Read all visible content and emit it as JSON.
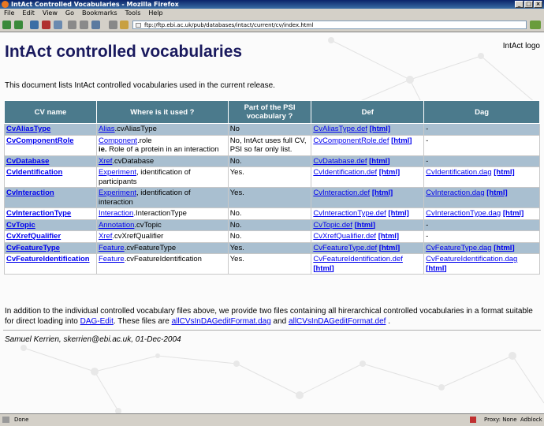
{
  "window": {
    "title": "IntAct Controlled Vocabularies - Mozilla Firefox"
  },
  "menu": [
    "File",
    "Edit",
    "View",
    "Go",
    "Bookmarks",
    "Tools",
    "Help"
  ],
  "address": {
    "url": "ftp://ftp.ebi.ac.uk/pub/databases/intact/current/cv/index.html"
  },
  "page": {
    "title": "IntAct controlled vocabularies",
    "logo_alt": "IntAct logo",
    "intro": "This document lists IntAct controlled vocabularies used in the current release.",
    "table": {
      "headers": [
        "CV name",
        "Where is it used ?",
        "Part of the PSI vocabulary ?",
        "Def",
        "Dag"
      ],
      "rows": [
        {
          "name": "CvAliasType",
          "where_link": "Alias",
          "where_rest": ".cvAliasType",
          "where_extra": "",
          "psi": "No",
          "def": "CvAliasType.def",
          "def_html": "[html]",
          "dag": "-",
          "dag_html": ""
        },
        {
          "name": "CvComponentRole",
          "where_link": "Component",
          "where_rest": ".role",
          "where_extra": "Role of a protein in an interaction",
          "psi": "No, IntAct uses full CV, PSI so far only list.",
          "def": "CvComponentRole.def",
          "def_html": "[html]",
          "dag": "-",
          "dag_html": ""
        },
        {
          "name": "CvDatabase",
          "where_link": "Xref",
          "where_rest": ".cvDatabase",
          "where_extra": "",
          "psi": "No.",
          "def": "CvDatabase.def",
          "def_html": "[html]",
          "dag": "-",
          "dag_html": ""
        },
        {
          "name": "CvIdentification",
          "where_link": "Experiment",
          "where_rest": ", identification of participants",
          "where_extra": "",
          "psi": "Yes.",
          "def": "CvIdentification.def",
          "def_html": "[html]",
          "dag": "CvIdentification.dag",
          "dag_html": "[html]"
        },
        {
          "name": "CvInteraction",
          "where_link": "Experiment",
          "where_rest": ", identification of interaction",
          "where_extra": "",
          "psi": "Yes.",
          "def": "CvInteraction.def",
          "def_html": "[html]",
          "dag": "CvInteraction.dag",
          "dag_html": "[html]"
        },
        {
          "name": "CvInteractionType",
          "where_link": "Interaction",
          "where_rest": ".InteractionType",
          "where_extra": "",
          "psi": "No.",
          "def": "CvInteractionType.def",
          "def_html": "[html]",
          "dag": "CvInteractionType.dag",
          "dag_html": "[html]"
        },
        {
          "name": "CvTopic",
          "where_link": "Annotation",
          "where_rest": ".cvTopic",
          "where_extra": "",
          "psi": "No.",
          "def": "CvTopic.def",
          "def_html": "[html]",
          "dag": "-",
          "dag_html": ""
        },
        {
          "name": "CvXrefQualifier",
          "where_link": "Xref",
          "where_rest": ".cvXrefQualifier",
          "where_extra": "",
          "psi": "No.",
          "def": "CvXrefQualifier.def",
          "def_html": "[html]",
          "dag": "-",
          "dag_html": ""
        },
        {
          "name": "CvFeatureType",
          "where_link": "Feature",
          "where_rest": ".cvFeatureType",
          "where_extra": "",
          "psi": "Yes.",
          "def": "CvFeatureType.def",
          "def_html": "[html]",
          "dag": "CvFeatureType.dag",
          "dag_html": "[html]"
        },
        {
          "name": "CvFeatureIdentification",
          "where_link": "Feature",
          "where_rest": ".cvFeatureIdentification",
          "where_extra": "",
          "psi": "Yes.",
          "def": "CvFeatureIdentification.def",
          "def_html": "[html]",
          "dag": "CvFeatureIdentification.dag",
          "dag_html": "[html]"
        }
      ],
      "ie_label": "ie."
    },
    "outro": {
      "text1": "In addition to the individual controlled vocabulary files above, we provide two files containing all hirerarchical controlled vocabularies in a format suitable for direct loading into ",
      "link_dagedit": "DAG-Edit",
      "text2": ". These files are ",
      "link_dag": "allCVsInDAGeditFormat.dag",
      "text3": " and ",
      "link_def": "allCVsInDAGeditFormat.def",
      "text4": " ."
    },
    "signature": "Samuel Kerrien, skerrien@ebi.ac.uk, 01-Dec-2004"
  },
  "status": {
    "left": "Done",
    "proxy": "Proxy: None",
    "adblock": "Adblock"
  },
  "colors": {
    "header": "#4b7a8c",
    "alt_row": "#a9bfd0",
    "title": "#1a1a5e",
    "link": "#0000ee"
  }
}
